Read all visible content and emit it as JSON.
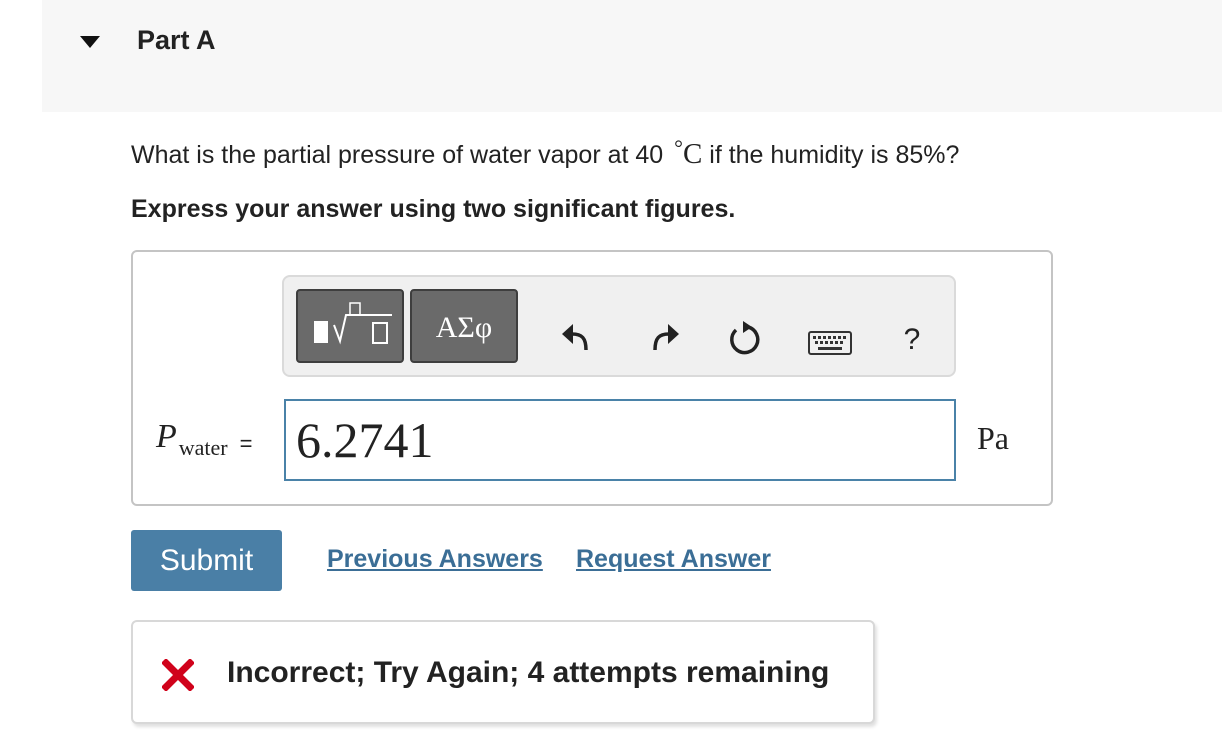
{
  "part": {
    "title": "Part A"
  },
  "question": {
    "text_before": "What is the partial pressure of water vapor at 40 ",
    "degree_symbol": "°",
    "unit_symbol": "C",
    "text_after": " if the humidity is 85%?"
  },
  "instruction": "Express your answer using two significant figures.",
  "toolbar": {
    "symbols_label": "ΑΣφ",
    "icons": [
      "templates-icon",
      "symbols-icon",
      "undo-icon",
      "redo-icon",
      "reset-icon",
      "keyboard-icon",
      "help-icon"
    ]
  },
  "answer": {
    "variable": "P",
    "subscript": "water",
    "equals": "=",
    "value": "6.2741",
    "unit": "Pa"
  },
  "actions": {
    "submit_label": "Submit",
    "previous_answers_label": "Previous Answers",
    "request_answer_label": "Request Answer"
  },
  "feedback": {
    "text": "Incorrect; Try Again; 4 attempts remaining"
  },
  "colors": {
    "submit_bg": "#4a7fa6",
    "link": "#3b6e96",
    "error_red": "#d0021b",
    "input_border": "#4a82a8"
  }
}
